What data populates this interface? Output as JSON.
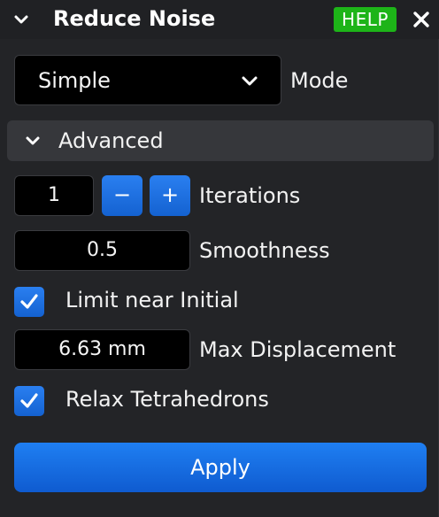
{
  "header": {
    "title": "Reduce Noise",
    "help_label": "HELP",
    "help_color": "#1db418"
  },
  "mode": {
    "selected": "Simple",
    "label": "Mode"
  },
  "advanced": {
    "title": "Advanced",
    "iterations": {
      "value": "1",
      "minus_label": "−",
      "plus_label": "+",
      "label": "Iterations"
    },
    "smoothness": {
      "value": "0.5",
      "label": "Smoothness"
    },
    "limit_near_initial": {
      "checked": true,
      "label": "Limit near Initial"
    },
    "max_displacement": {
      "value": "6.63 mm",
      "label": "Max Displacement"
    },
    "relax_tetrahedrons": {
      "checked": true,
      "label": "Relax Tetrahedrons"
    }
  },
  "apply_label": "Apply",
  "accent_color": "#1a6fe0"
}
